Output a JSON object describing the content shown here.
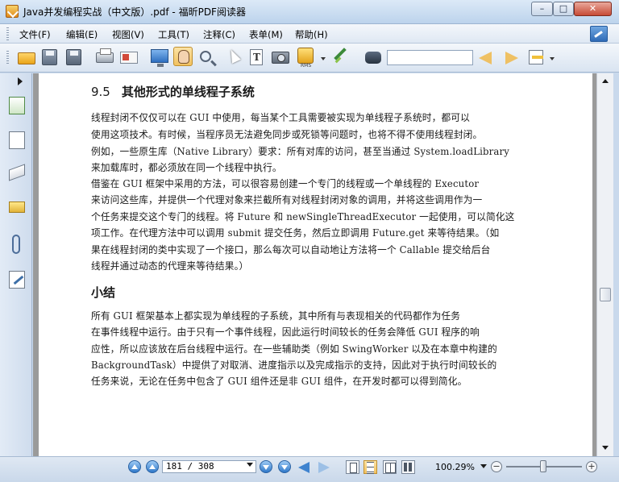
{
  "window": {
    "title": "Java并发编程实战（中文版）.pdf - 福昕PDF阅读器",
    "minimize_label": "–",
    "maximize_label": "□",
    "close_label": "✕"
  },
  "menu": {
    "items": [
      {
        "label": "文件(F)"
      },
      {
        "label": "编辑(E)"
      },
      {
        "label": "视图(V)"
      },
      {
        "label": "工具(T)"
      },
      {
        "label": "注释(C)"
      },
      {
        "label": "表单(M)"
      },
      {
        "label": "帮助(H)"
      }
    ]
  },
  "toolbar": {
    "rms_label": "RMS",
    "search_placeholder": "",
    "search_value": ""
  },
  "document": {
    "section_number": "9.5",
    "section_title": "其他形式的单线程子系统",
    "paragraph1_lines": [
      "    线程封闭不仅仅可以在 GUI 中使用，每当某个工具需要被实现为单线程子系统时，都可以",
      "使用这项技术。有时候，当程序员无法避免同步或死锁等问题时，也将不得不使用线程封闭。",
      "例如，一些原生库（Native Library）要求：所有对库的访问，甚至当通过 System.loadLibrary",
      "来加载库时，都必须放在同一个线程中执行。"
    ],
    "paragraph2_lines": [
      "    借鉴在 GUI 框架中采用的方法，可以很容易创建一个专门的线程或一个单线程的 Executor",
      "来访问这些库，并提供一个代理对象来拦截所有对线程封闭对象的调用，并将这些调用作为一",
      "个任务来提交这个专门的线程。将 Future 和 newSingleThreadExecutor 一起使用，可以简化这",
      "项工作。在代理方法中可以调用 submit 提交任务，然后立即调用 Future.get 来等待结果。（如",
      "果在线程封闭的类中实现了一个接口，那么每次可以自动地让方法将一个 Callable 提交给后台",
      "线程并通过动态的代理来等待结果。）"
    ],
    "summary_title": "小结",
    "paragraph3_lines": [
      "    所有 GUI 框架基本上都实现为单线程的子系统，其中所有与表现相关的代码都作为任务",
      "在事件线程中运行。由于只有一个事件线程，因此运行时间较长的任务会降低 GUI 程序的响",
      "应性，所以应该放在后台线程中运行。在一些辅助类（例如 SwingWorker 以及在本章中构建的",
      "BackgroundTask）中提供了对取消、进度指示以及完成指示的支持，因此对于执行时间较长的",
      "任务来说，无论在任务中包含了 GUI 组件还是非 GUI 组件，在开发时都可以得到简化。"
    ]
  },
  "status": {
    "page_display": "181 / 308",
    "zoom": "100.29%",
    "zoom_minus": "−",
    "zoom_plus": "+"
  }
}
